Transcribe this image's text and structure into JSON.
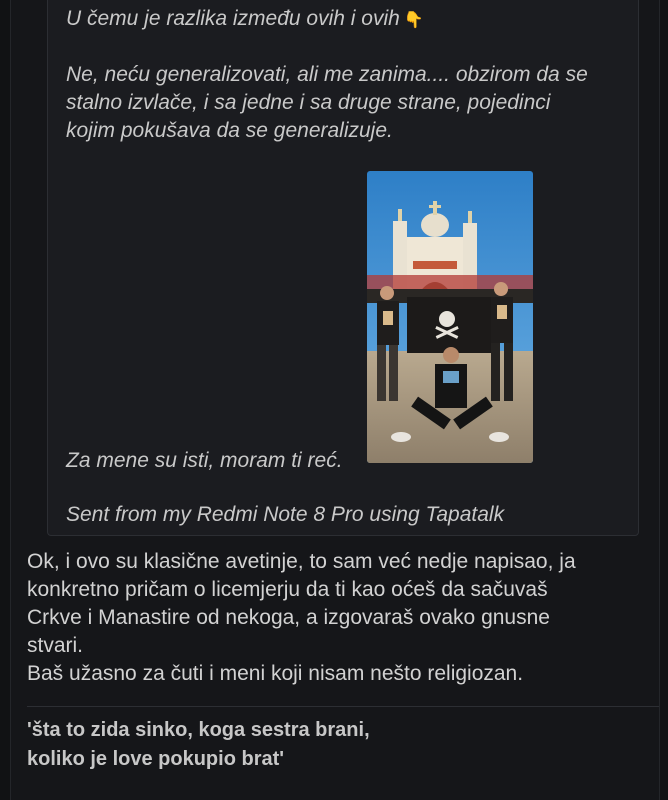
{
  "quote": {
    "line1": "U čemu je razlika između ovih i ovih",
    "emoji": "pointing-down-hand-icon",
    "para2": [
      "Ne, neću generalizovati, ali me zanima.... obzirom da se",
      "stalno izvlače, i sa jedne i sa druge strane, pojedinci",
      "kojim pokušava da se generalizuje."
    ],
    "after_image": "Za mene su isti, moram ti reć.",
    "sent_from": "Sent from my Redmi Note 8 Pro using Tapatalk"
  },
  "reply": {
    "lines": [
      "Ok, i ovo su klasične avetinje, to sam već nedje napisao, ja",
      "konkretno pričam o licemjerju da ti kao oćeš da sačuvaš",
      "Crkve i Manastire od nekoga, a izgovaraš ovako gnusne",
      "stvari.",
      "Baš užasno za čuti i meni koji nisam nešto religiozan."
    ]
  },
  "signature": {
    "line1": "'šta to zida sinko, koga sestra brani,",
    "line2": "koliko je love pokupio brat'"
  },
  "colors": {
    "page_bg": "#111214",
    "quote_bg": "#1b1c20",
    "text": "#d2d2d2"
  }
}
